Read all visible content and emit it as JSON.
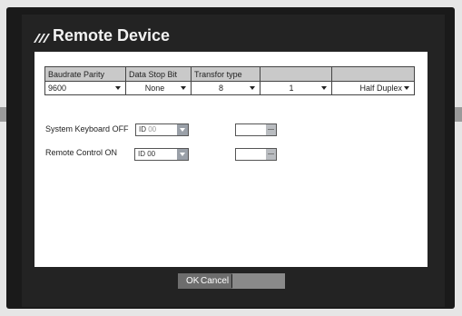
{
  "dialog": {
    "title": "Remote Device"
  },
  "table": {
    "headers": [
      "Baudrate Parity",
      "Data",
      "Stop Bit",
      "Transfor type",
      ""
    ],
    "values": [
      "9600",
      "None",
      "8",
      "1",
      "Half Duplex"
    ]
  },
  "system_keyboard": {
    "label": "System Keyboard",
    "state": "OFF",
    "id_label": "ID",
    "id_value": "00"
  },
  "remote_control": {
    "label": "Remote Control",
    "state": "ON",
    "id_label": "ID",
    "id_value": "00"
  },
  "buttons": {
    "ok": "OK",
    "cancel": "Cancel"
  },
  "colors": {
    "frame": "#1a1a1a",
    "header": "#c9c9c9",
    "button": "#6d6d6d"
  }
}
